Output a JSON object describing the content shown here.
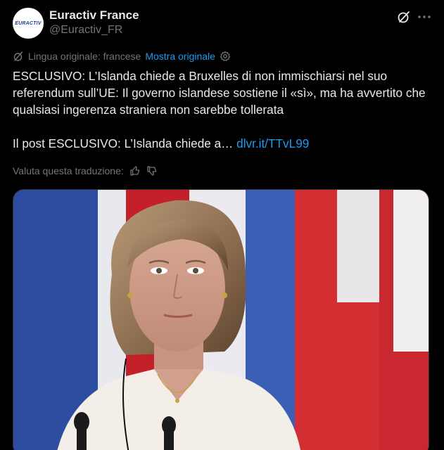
{
  "author": {
    "name": "Euractiv France",
    "handle": "@Euractiv_FR",
    "avatar_text": "EURACTIV"
  },
  "translation": {
    "label": "Lingua originale: francese",
    "show_original": "Mostra originale"
  },
  "tweet": {
    "line1": "ESCLUSIVO: L’Islanda chiede a Bruxelles di non immischiarsi nel suo referendum sull’UE: Il governo islandese sostiene il «sì», ma ha avvertito che qualsiasi ingerenza straniera non sarebbe tollerata",
    "line2_prefix": "Il post ESCLUSIVO: L’Islanda chiede a…",
    "link": "dlvr.it/TTvL99"
  },
  "rating": {
    "label": "Valuta questa traduzione:"
  },
  "icons": {
    "grok": "grok-icon",
    "more": "more-dots-icon",
    "translate": "translate-icon",
    "settings": "settings-icon",
    "thumbs_up": "thumbs-up-icon",
    "thumbs_down": "thumbs-down-icon"
  },
  "colors": {
    "background": "#000000",
    "text": "#e7e9ea",
    "muted": "#71767b",
    "link": "#1d9bf0"
  }
}
